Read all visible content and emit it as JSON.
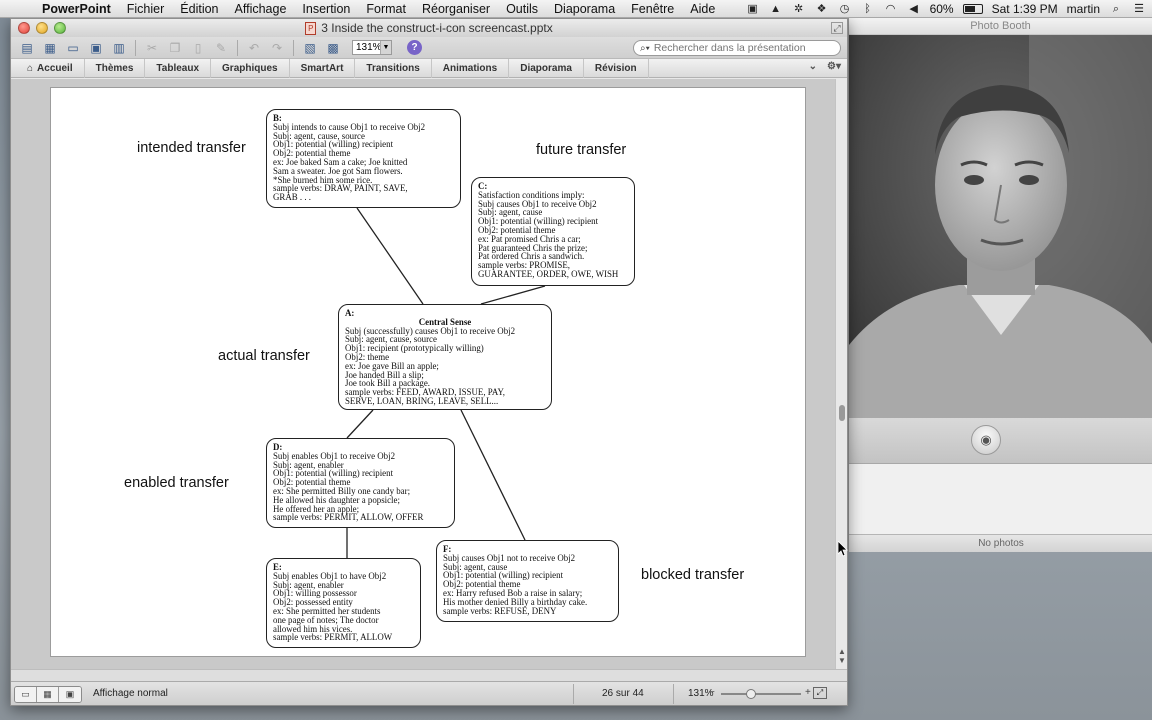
{
  "menubar": {
    "app_name": "PowerPoint",
    "items": [
      "Fichier",
      "Édition",
      "Affichage",
      "Insertion",
      "Format",
      "Réorganiser",
      "Outils",
      "Diaporama",
      "Fenêtre",
      "Aide"
    ],
    "battery_percent": "60%",
    "clock": "Sat 1:39 PM",
    "user": "martin"
  },
  "ppt": {
    "document_title": "3 Inside the construct-i-con screencast.pptx",
    "zoom_value": "131%",
    "search_placeholder": "Rechercher dans la présentation",
    "ribbon_tabs": [
      "Accueil",
      "Thèmes",
      "Tableaux",
      "Graphiques",
      "SmartArt",
      "Transitions",
      "Animations",
      "Diaporama",
      "Révision"
    ],
    "status": {
      "view_label": "Affichage normal",
      "slide_position": "26 sur 44",
      "zoom": "131%",
      "zoom_level": 0.35
    }
  },
  "slide": {
    "labels": {
      "intended": "intended transfer",
      "future": "future transfer",
      "actual": "actual transfer",
      "enabled": "enabled transfer",
      "blocked": "blocked transfer"
    },
    "boxes": {
      "b": {
        "letter": "B:",
        "lines": [
          "Subj intends to cause Obj1 to receive Obj2",
          "Subj:  agent, cause, source",
          "Obj1:  potential (willing) recipient",
          "Obj2:  potential theme",
          "ex: Joe baked Sam a cake; Joe knitted",
          "Sam a sweater.  Joe got Sam flowers.",
          "*She burned him some rice.",
          "sample verbs:  DRAW, PAINT, SAVE,",
          "GRAB . . ."
        ]
      },
      "c": {
        "letter": "C:",
        "lines": [
          "Satisfaction conditions imply:",
          "Subj causes Obj1 to receive Obj2",
          "Subj:  agent, cause",
          "Obj1: potential (willing) recipient",
          "Obj2:  potential theme",
          "ex:  Pat promised Chris a car;",
          "Pat guaranteed Chris the prize;",
          "Pat ordered Chris a sandwich.",
          "sample verbs: PROMISE,",
          "GUARANTEE, ORDER, OWE, WISH"
        ]
      },
      "a": {
        "letter": "A:",
        "heading": "Central Sense",
        "lines": [
          "Subj (successfully) causes Obj1 to receive Obj2",
          "Subj:   agent, cause, source",
          "Obj1:   recipient (prototypically willing)",
          "Obj2:   theme",
          "ex:  Joe gave Bill an apple;",
          "Joe handed Bill a slip;",
          "Joe took Bill a package.",
          "sample verbs:  FEED, AWARD, ISSUE,  PAY,",
          "SERVE, LOAN, BRING, LEAVE, SELL..."
        ]
      },
      "d": {
        "letter": "D:",
        "lines": [
          "Subj enables Obj1 to receive Obj2",
          "Subj:  agent, enabler",
          "Obj1: potential (willing) recipient",
          "Obj2: potential theme",
          "ex: She permitted Billy one candy bar;",
          "He allowed his daughter a popsicle;",
          "He offered her an apple;",
          "sample verbs: PERMIT, ALLOW, OFFER"
        ]
      },
      "e": {
        "letter": "E:",
        "lines": [
          "Subj enables Obj1 to have Obj2",
          "Subj:  agent, enabler",
          "Obj1:  willing possessor",
          "Obj2:  possessed entity",
          "ex:  She permitted her students",
          "one page of notes;  The doctor",
          "allowed him his vices.",
          "sample verbs:  PERMIT, ALLOW"
        ]
      },
      "f": {
        "letter": "F:",
        "lines": [
          "Subj causes Obj1 not to receive Obj2",
          "Subj:  agent, cause",
          "Obj1: potential (willing) recipient",
          "Obj2: potential theme",
          "ex:  Harry refused Bob a raise in salary;",
          "His mother denied Billy a birthday cake.",
          "sample verbs: REFUSE, DENY"
        ]
      }
    }
  },
  "photobooth": {
    "title": "Photo Booth",
    "status": "No photos"
  },
  "colors": {
    "ribbon_text": "#333333",
    "help_purple": "#7864c8",
    "slide_background": "#ffffff"
  }
}
